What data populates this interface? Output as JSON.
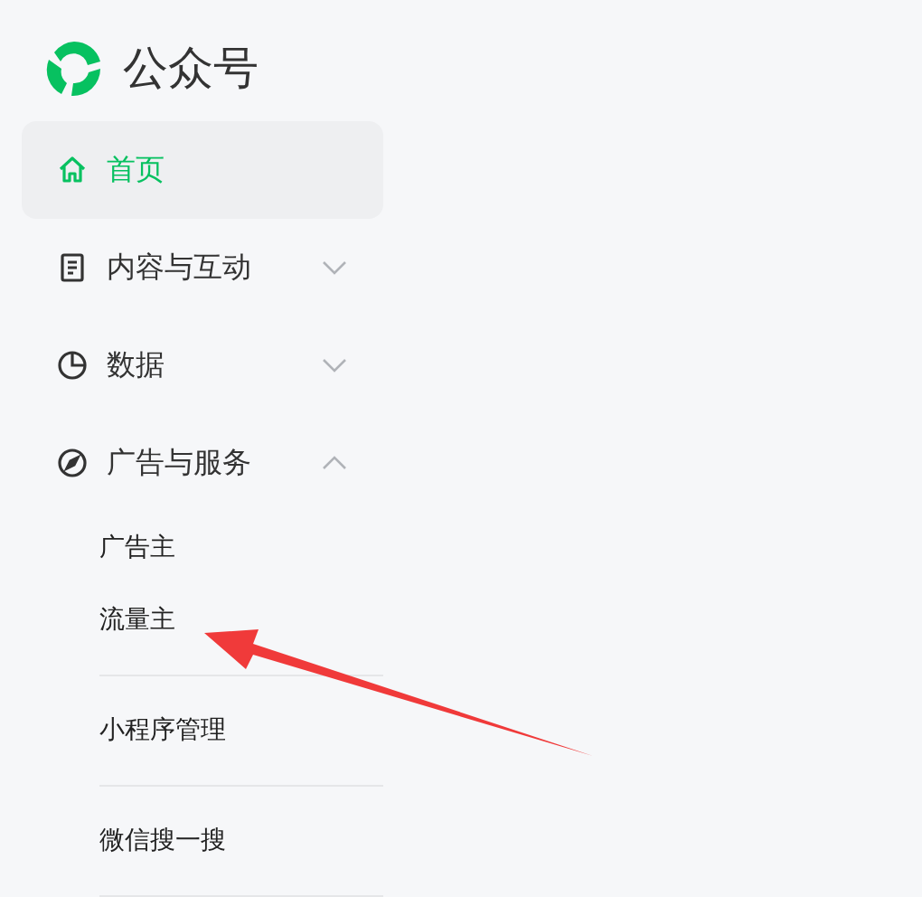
{
  "brand": {
    "title": "公众号"
  },
  "nav": [
    {
      "label": "首页",
      "kind": "home",
      "selected": true
    },
    {
      "label": "内容与互动",
      "kind": "document",
      "selected": false,
      "expanded": false
    },
    {
      "label": "数据",
      "kind": "pie",
      "selected": false,
      "expanded": false
    },
    {
      "label": "广告与服务",
      "kind": "compass",
      "selected": false,
      "expanded": true,
      "groups": [
        [
          "广告主",
          "流量主"
        ],
        [
          "小程序管理"
        ],
        [
          "微信搜一搜"
        ]
      ]
    }
  ],
  "annotation": {
    "kind": "arrow"
  }
}
